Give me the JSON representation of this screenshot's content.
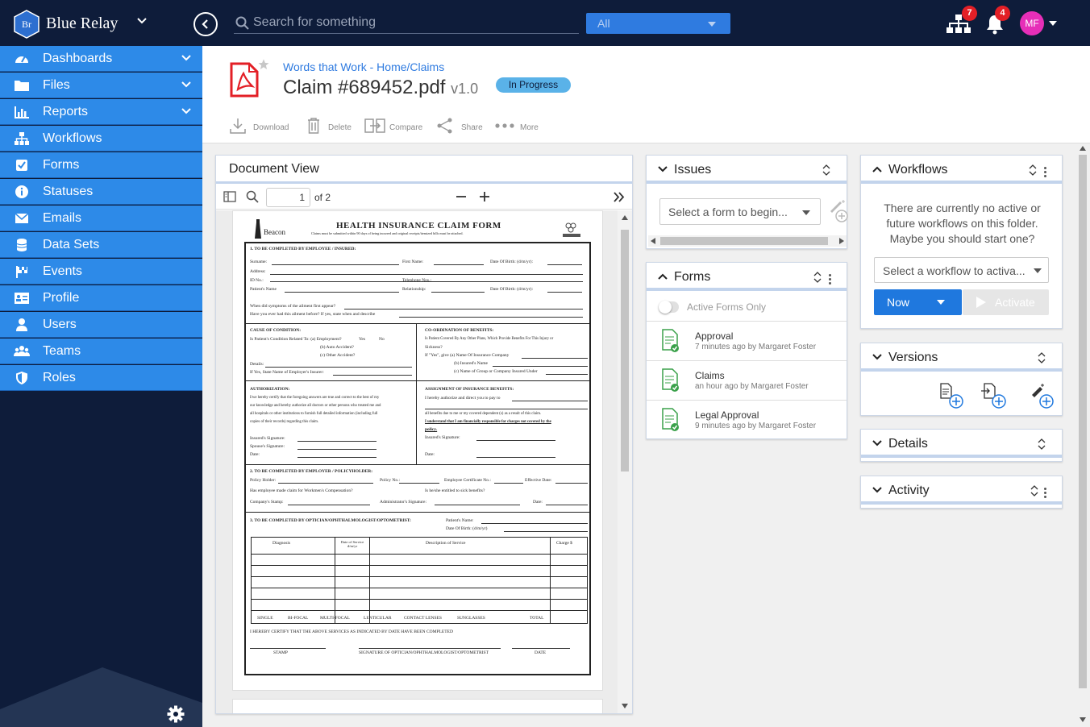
{
  "topbar": {
    "logo_text": "Br",
    "brand": "Blue Relay",
    "search_placeholder": "Search for something",
    "scope": "All",
    "workflow_badge": "7",
    "notif_badge": "4",
    "avatar": "MF"
  },
  "sidebar": {
    "items": [
      {
        "label": "Dashboards",
        "icon": "dashboard-icon"
      },
      {
        "label": "Files",
        "icon": "folder-icon"
      },
      {
        "label": "Reports",
        "icon": "bar-chart-icon"
      },
      {
        "label": "Workflows",
        "icon": "sitemap-icon"
      },
      {
        "label": "Forms",
        "icon": "checkbox-icon"
      },
      {
        "label": "Statuses",
        "icon": "info-icon"
      },
      {
        "label": "Emails",
        "icon": "envelope-icon"
      },
      {
        "label": "Data Sets",
        "icon": "database-icon"
      },
      {
        "label": "Events",
        "icon": "flag-icon"
      },
      {
        "label": "Profile",
        "icon": "id-card-icon"
      },
      {
        "label": "Users",
        "icon": "user-icon"
      },
      {
        "label": "Teams",
        "icon": "users-icon"
      },
      {
        "label": "Roles",
        "icon": "shield-icon"
      }
    ]
  },
  "header": {
    "breadcrumb": "Words that Work - Home/Claims",
    "title": "Claim #689452.pdf",
    "version": "v1.0",
    "status": "In Progress"
  },
  "toolbar": {
    "download": "Download",
    "delete": "Delete",
    "compare": "Compare",
    "share": "Share",
    "more": "More"
  },
  "document_view": {
    "title": "Document View",
    "page": "1",
    "page_of": "of 2"
  },
  "form_doc": {
    "brand": "Beacon",
    "title": "HEALTH INSURANCE CLAIM FORM",
    "subtitle": "Claims must be submitted within 90 days of being incurred and original receipts/itemized bills must be attached.",
    "s1": "1.      TO BE COMPLETED BY EMPLOYEE / INSURED:",
    "surname": "Surname:",
    "first_name": "First Name:",
    "dob": "Date Of Birth: (d/m/yr):",
    "address": "Address:",
    "id_no": "ID No.:",
    "tel": "Telephone Nos.:",
    "patient": "Patient's Name",
    "relationship": "Relationship:",
    "dob2": "Date Of Birth: (d/m/yr):",
    "q1": "When did symptoms of the ailment first appear?",
    "q2": "Have you ever had this ailment before? If yes, state when and describe",
    "cause": "CAUSE OF CONDITION:",
    "cause_q": "Is Patient's Condition Related To:  (a) Employment?",
    "auto": "(b) Auto Accident?",
    "other": "(c) Other Accident?",
    "details": "Details:",
    "if_yes": "If Yes, State Name of Employer's Insurer:",
    "coord": "CO-ORDINATION OF BENEFITS:",
    "coord_q": "Is Patient Covered By Any Other Plans, Which Provide Benefits For This Injury or",
    "sickness": "Sickness?",
    "if_yes2": "If \"Yes\", give  (a)  Name Of Insurance Company",
    "insured_name": "(b)  Insured's Name",
    "group": "(c)  Name of Group or Company Insured Under",
    "yes": "Yes",
    "no": "No",
    "auth": "AUTHORIZATION:",
    "auth_text1": "I/we hereby certify that the foregoing answers are true and correct to the best of my",
    "auth_text2": "our knowledge and hereby authorize all doctors or other persons who treated me and",
    "auth_text3": "all hospitals or other institutions to furnish full detailed information (including full",
    "auth_text4": "copies of their records) regarding this claim.",
    "insured_sig": "Insured's Signature:",
    "spouse_sig": "Spouse's Signature:",
    "date": "Date:",
    "assign": "ASSIGNMENT OF INSURANCE BENEFITS:",
    "assign1": "I hereby authorize and direct you to pay to",
    "assign2": "all benefits due to me or my covered dependent (s) as a result of this claim.",
    "assign3": "I understand that I am financially responsible for charges not covered by the",
    "assign4": "policy.",
    "s2": "2.  TO BE COMPLETED BY EMPLOYER / POLICYHOLDER:",
    "policy_holder": "Policy Holder:",
    "policy_no": "Policy No.:",
    "emp_cert": "Employee Certificate No.:",
    "eff_date": "Effective Date:",
    "wc": "Has employee made claim for Workmen's Compensation?",
    "entitled": "Is he/she entitled to sick benefits?",
    "stamp": "Company's Stamp:",
    "admin_sig": "Administrator's Signature:",
    "date2": "Date:",
    "s3": "3.  TO BE COMPLETED BY OPTICIAN/OPHTHALMOLOGIST/OPTOMETRIST:",
    "patient_name": "Patient's Name:",
    "dob3": "Date Of Birth: (d/m/yr)",
    "col_diag": "Diagnosis",
    "col_date": "Date of Service d/m/yr",
    "col_desc": "Description of Service",
    "col_charge": "Charge $",
    "single": "SINGLE",
    "bifocal": "BI-FOCAL",
    "multifocal": "MULTI-FOCAL",
    "lenticular": "LENTICULAR",
    "contact": "CONTACT LENSES",
    "sunglasses": "SUNGLASSES",
    "total": "TOTAL",
    "certify": "I HEREBY CERTIFY THAT THE ABOVE SERVICES AS INDICATED BY DATE HAVE BEEN COMPLETED",
    "stamp2": "STAMP",
    "sig_opt": "SIGNATURE OF OPTICIAN/OPHTHALMOLOGIST/OPTOMETRIST",
    "date3": "DATE"
  },
  "issues": {
    "title": "Issues",
    "select": "Select a form to begin..."
  },
  "forms": {
    "title": "Forms",
    "toggle": "Active Forms Only",
    "items": [
      {
        "name": "Approval",
        "meta": "7 minutes ago by Margaret Foster"
      },
      {
        "name": "Claims",
        "meta": "an hour ago by Margaret Foster"
      },
      {
        "name": "Legal Approval",
        "meta": "9 minutes ago by Margaret Foster"
      }
    ]
  },
  "workflows": {
    "title": "Workflows",
    "empty": "There are currently no active or future workflows on this folder. Maybe you should start one?",
    "select": "Select a workflow to activa...",
    "now": "Now",
    "activate": "Activate"
  },
  "versions": {
    "title": "Versions"
  },
  "details": {
    "title": "Details"
  },
  "activity": {
    "title": "Activity"
  }
}
